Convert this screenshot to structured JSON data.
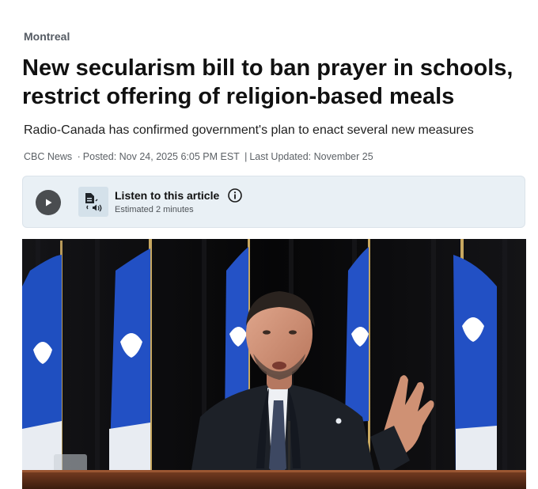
{
  "article": {
    "section": "Montreal",
    "headline": "New secularism bill to ban prayer in schools, restrict offering of religion-based meals",
    "subheadline": "Radio-Canada has confirmed government's plan to enact several new measures",
    "byline": {
      "source": "CBC News",
      "separator": "·",
      "posted": "Posted: Nov 24, 2025 6:05 PM EST",
      "divider": "|",
      "updated": "Last Updated: November 25"
    }
  },
  "audio_player": {
    "title": "Listen to this article",
    "duration": "Estimated 2 minutes",
    "play_icon": "play-icon",
    "article_audio_icon": "document-speaker-icon",
    "info_icon": "info-icon"
  },
  "hero_image": {
    "subject": "man in suit speaking at podium in front of Quebec flags",
    "colors": {
      "flag_blue": "#1f4fc0",
      "curtain": "#0b0b0d",
      "podium": "#5a2e1a"
    }
  }
}
